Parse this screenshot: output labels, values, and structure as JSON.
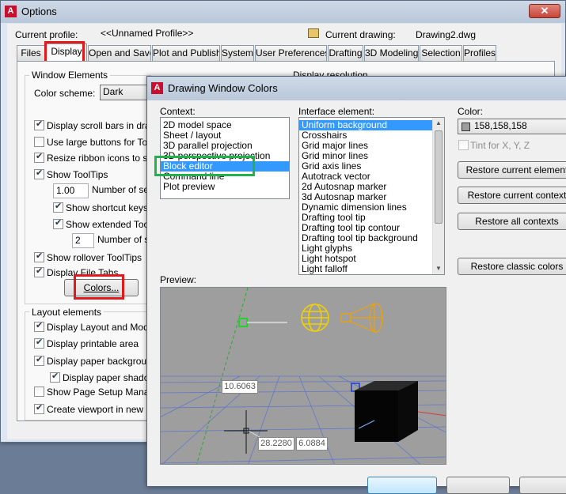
{
  "options": {
    "title": "Options",
    "current_profile_label": "Current profile:",
    "current_profile_value": "<<Unnamed Profile>>",
    "current_drawing_label": "Current drawing:",
    "current_drawing_value": "Drawing2.dwg",
    "tabs": [
      "Files",
      "Display",
      "Open and Save",
      "Plot and Publish",
      "System",
      "User Preferences",
      "Drafting",
      "3D Modeling",
      "Selection",
      "Profiles"
    ],
    "active_tab": "Display",
    "window_elements": {
      "legend": "Window Elements",
      "color_scheme_label": "Color scheme:",
      "color_scheme_value": "Dark",
      "display_scroll_bars": "Display scroll bars in drawing",
      "large_buttons": "Use large buttons for Toolbars",
      "resize_ribbon": "Resize ribbon icons to standard",
      "show_tooltips": "Show ToolTips",
      "tooltip_delay_value": "1.00",
      "tooltip_delay_label": "Number of seconds",
      "show_shortcut_keys": "Show shortcut keys in ToolTips",
      "show_extended_tooltips": "Show extended ToolTips",
      "extended_delay_value": "2",
      "extended_delay_label": "Number of seconds",
      "show_rollover": "Show rollover ToolTips",
      "display_file_tabs": "Display File Tabs",
      "colors_button": "Colors..."
    },
    "display_resolution_legend": "Display resolution",
    "layout_elements": {
      "legend": "Layout elements",
      "display_layout_model_tabs": "Display Layout and Model tabs",
      "display_printable_area": "Display printable area",
      "display_paper_background": "Display paper background",
      "display_paper_shadow": "Display paper shadow",
      "show_page_setup": "Show Page Setup Manager",
      "create_viewport": "Create viewport in new layouts"
    }
  },
  "dwc": {
    "title": "Drawing Window Colors",
    "context_label": "Context:",
    "contexts": [
      "2D model space",
      "Sheet / layout",
      "3D parallel projection",
      "3D perspective projection",
      "Block editor",
      "Command line",
      "Plot preview"
    ],
    "selected_context": "Block editor",
    "interface_label": "Interface element:",
    "interface_elements": [
      "Uniform background",
      "Crosshairs",
      "Grid major lines",
      "Grid minor lines",
      "Grid axis lines",
      "Autotrack vector",
      "2d Autosnap marker",
      "3d Autosnap marker",
      "Dynamic dimension lines",
      "Drafting tool tip",
      "Drafting tool tip contour",
      "Drafting tool tip background",
      "Light glyphs",
      "Light hotspot",
      "Light falloff"
    ],
    "selected_interface": "Uniform background",
    "color_label": "Color:",
    "color_value": "158,158,158",
    "swatch_color": "#9e9e9e",
    "tint_label": "Tint for X, Y, Z",
    "restore_element": "Restore current element",
    "restore_context": "Restore current context",
    "restore_all": "Restore all contexts",
    "restore_classic": "Restore classic colors",
    "preview_label": "Preview:",
    "preview": {
      "dim1": "10.6063",
      "dim2": "28.2280",
      "dim3": "6.0884"
    }
  },
  "colors": {
    "highlight_red": "#e0191c",
    "highlight_green": "#22b14c",
    "selection": "#3399ff"
  }
}
